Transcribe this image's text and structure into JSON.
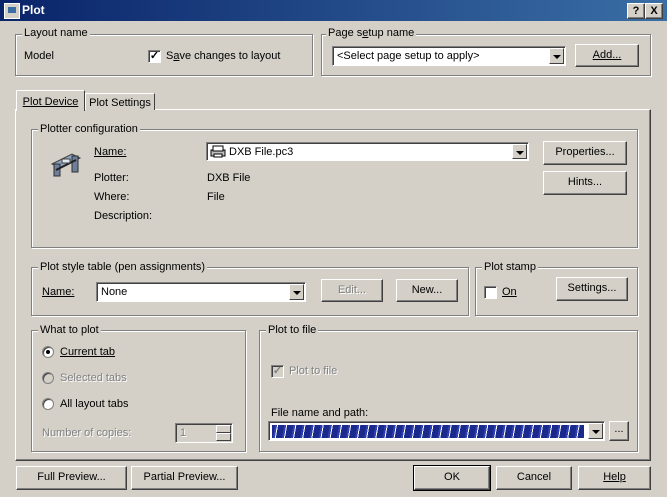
{
  "window": {
    "title": "Plot",
    "help_btn": "?",
    "close_btn": "X"
  },
  "layout_name": {
    "group_label": "Layout name",
    "value": "Model",
    "save_changes_label_pre": "S",
    "save_changes_label_u": "a",
    "save_changes_label_post": "ve changes to layout",
    "save_changes_checked": true
  },
  "page_setup": {
    "group_label_pre": "Page s",
    "group_label_u": "e",
    "group_label_post": "tup name",
    "selected": "<Select page setup to apply>",
    "add_button": "Add..."
  },
  "tabs": [
    {
      "label": "Plot Device",
      "active": true
    },
    {
      "label": "Plot Settings",
      "active": false
    }
  ],
  "plotter_config": {
    "group_label": "Plotter configuration",
    "name_label": "Name:",
    "name_value": "DXB File.pc3",
    "plotter_label": "Plotter:",
    "plotter_value": "DXB File",
    "where_label": "Where:",
    "where_value": "File",
    "description_label": "Description:",
    "properties_button": "Properties...",
    "hints_button": "Hints..."
  },
  "plot_style": {
    "group_label": "Plot style table (pen assignments)",
    "name_label": "Name:",
    "name_value": "None",
    "edit_button": "Edit...",
    "new_button": "New..."
  },
  "plot_stamp": {
    "group_label": "Plot stamp",
    "on_label": "On",
    "on_checked": false,
    "settings_button": "Settings..."
  },
  "what_to_plot": {
    "group_label": "What to plot",
    "options": [
      {
        "label": "Current tab",
        "selected": true,
        "enabled": true
      },
      {
        "label": "Selected tabs",
        "selected": false,
        "enabled": false
      },
      {
        "label": "All layout tabs",
        "selected": false,
        "enabled": true
      }
    ],
    "copies_label": "Number of copies:",
    "copies_value": "1"
  },
  "plot_to_file": {
    "group_label": "Plot to file",
    "checkbox_label": "Plot to file",
    "checkbox_checked": true,
    "path_label": "File name and path:",
    "browse_button": "..."
  },
  "footer": {
    "full_preview": "Full Preview...",
    "partial_preview": "Partial Preview...",
    "ok": "OK",
    "cancel": "Cancel",
    "help": "Help"
  }
}
